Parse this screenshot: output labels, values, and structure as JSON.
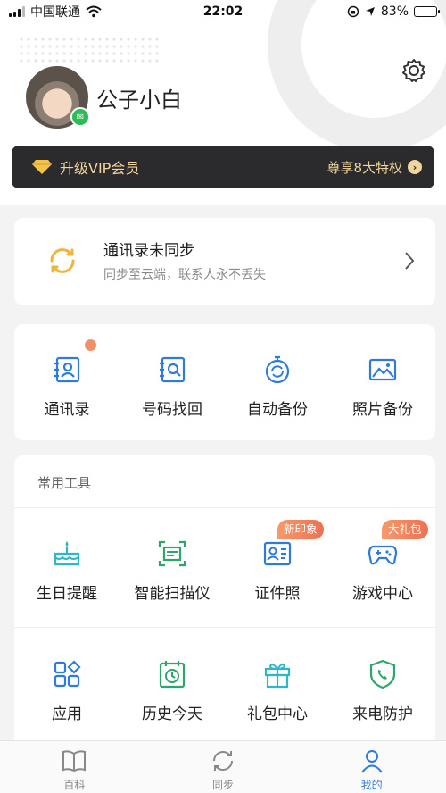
{
  "status_bar": {
    "carrier": "中国联通",
    "time": "22:02",
    "battery": "83%",
    "battery_level": 0.83
  },
  "profile": {
    "username": "公子小白"
  },
  "vip": {
    "label": "升级VIP会员",
    "benefits": "尊享8大特权",
    "accent": "#f2d59c"
  },
  "sync_card": {
    "title": "通讯录未同步",
    "subtitle": "同步至云端，联系人永不丢失"
  },
  "quick_actions": [
    {
      "label": "通讯录",
      "icon": "contacts-icon",
      "badge_dot": true
    },
    {
      "label": "号码找回",
      "icon": "number-recover-icon"
    },
    {
      "label": "自动备份",
      "icon": "auto-backup-icon"
    },
    {
      "label": "照片备份",
      "icon": "photo-backup-icon"
    }
  ],
  "tools": {
    "title": "常用工具",
    "row1": [
      {
        "label": "生日提醒",
        "icon": "cake-icon"
      },
      {
        "label": "智能扫描仪",
        "icon": "scanner-icon"
      },
      {
        "label": "证件照",
        "icon": "id-card-icon",
        "tag": "新印象"
      },
      {
        "label": "游戏中心",
        "icon": "gamepad-icon",
        "tag": "大礼包"
      }
    ],
    "row2": [
      {
        "label": "应用",
        "icon": "apps-icon"
      },
      {
        "label": "历史今天",
        "icon": "calendar-clock-icon"
      },
      {
        "label": "礼包中心",
        "icon": "gift-icon"
      },
      {
        "label": "来电防护",
        "icon": "shield-phone-icon"
      }
    ]
  },
  "bottom_nav": [
    {
      "label": "百科",
      "icon": "book-icon"
    },
    {
      "label": "同步",
      "icon": "sync-icon"
    },
    {
      "label": "我的",
      "icon": "profile-icon",
      "active": true
    }
  ],
  "colors": {
    "primary": "#2e7bd9",
    "tag": "#ee7053",
    "sync": "#f0b43c"
  }
}
